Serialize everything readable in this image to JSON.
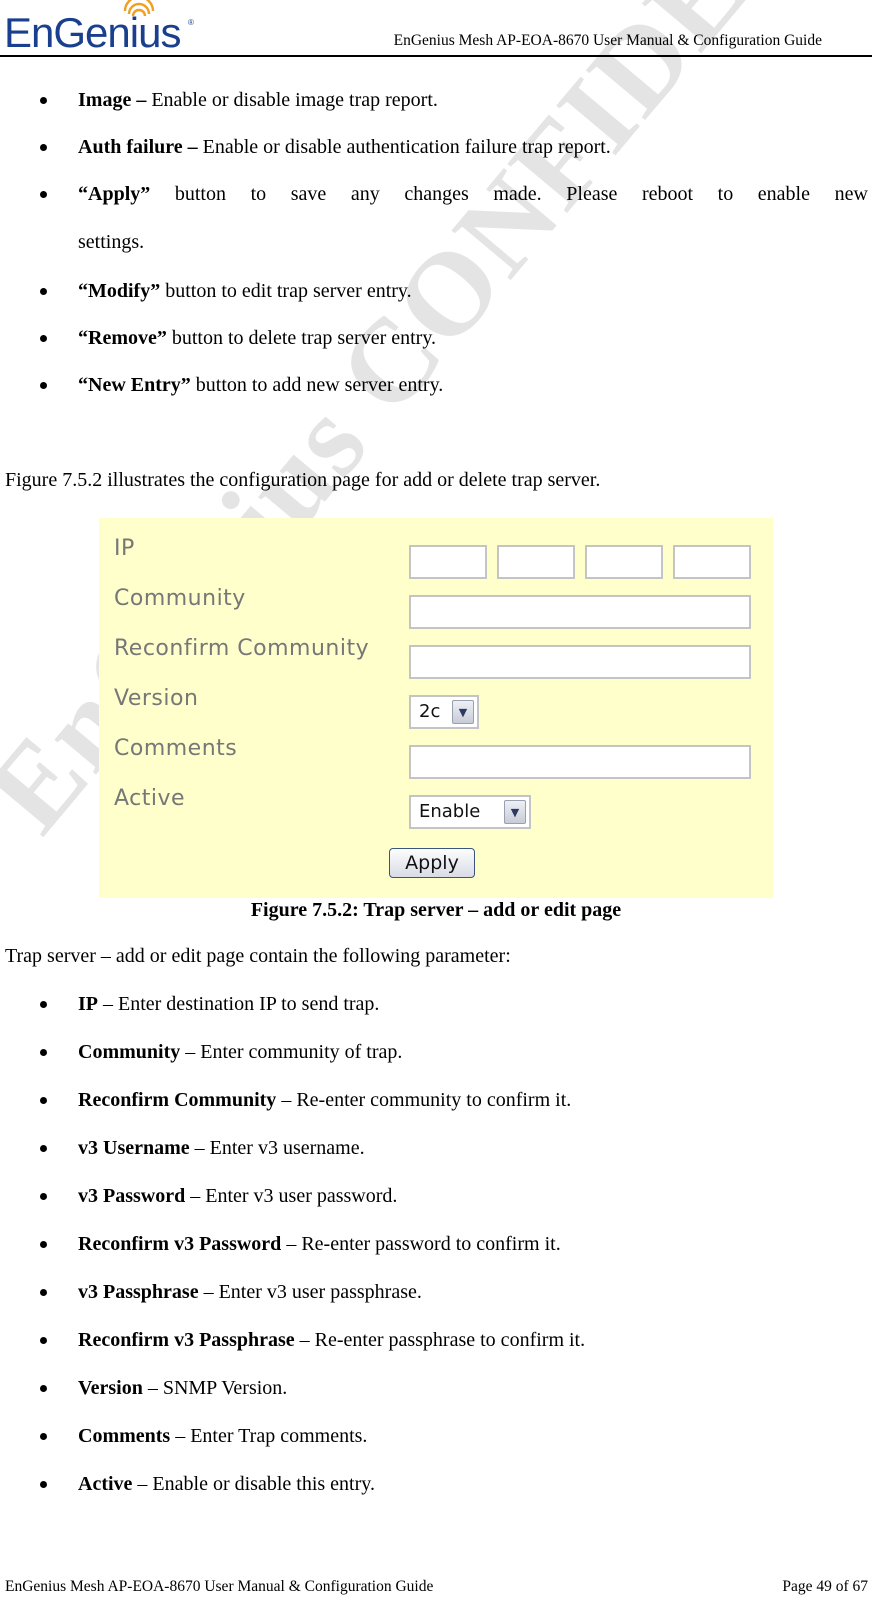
{
  "header": {
    "logo_text": "EnGenius",
    "logo_registered": "®",
    "title": "EnGenius Mesh AP-EOA-8670 User Manual & Configuration Guide"
  },
  "watermark": "EnGenius CONFIDENTIAL",
  "top_bullets": [
    {
      "bold": "Image –",
      "text": " Enable or disable image trap report."
    },
    {
      "bold": "Auth failure –",
      "text": " Enable or disable authentication failure trap report."
    },
    {
      "bold": "“Apply”",
      "text_words": [
        "button",
        "to",
        "save",
        "any",
        "changes",
        "made.",
        "Please",
        "reboot",
        "to",
        "enable",
        "new"
      ],
      "continuation": "settings."
    },
    {
      "bold": "“Modify”",
      "text": " button to edit trap server entry."
    },
    {
      "bold": "“Remove”",
      "text": " button to delete trap server entry."
    },
    {
      "bold": "“New Entry”",
      "text": " button to add new server entry."
    }
  ],
  "intro_paragraph": "Figure 7.5.2 illustrates the configuration page for add or delete trap server.",
  "figure": {
    "colors": {
      "background": "#ffffcc",
      "label": "#777777"
    },
    "fields": [
      {
        "label": "IP",
        "type": "ip",
        "values": [
          "",
          "",
          "",
          ""
        ]
      },
      {
        "label": "Community",
        "type": "text",
        "value": ""
      },
      {
        "label": "Reconfirm Community",
        "type": "text",
        "value": ""
      },
      {
        "label": "Version",
        "type": "select",
        "value": "2c"
      },
      {
        "label": "Comments",
        "type": "text",
        "value": ""
      },
      {
        "label": "Active",
        "type": "select",
        "value": "Enable"
      }
    ],
    "apply_label": "Apply",
    "caption": "Figure 7.5.2: Trap server – add or edit page"
  },
  "params_intro": "Trap server – add or edit page contain the following parameter:",
  "params": [
    {
      "bold": "IP",
      "text": " – Enter destination IP to send trap."
    },
    {
      "bold": "Community",
      "text": " – Enter community of trap."
    },
    {
      "bold": "Reconfirm Community",
      "text": " – Re-enter community to confirm it."
    },
    {
      "bold": "v3 Username",
      "text": " – Enter v3 username."
    },
    {
      "bold": "v3 Password",
      "text": " – Enter v3 user password."
    },
    {
      "bold": "Reconfirm v3 Password",
      "text": " – Re-enter password to confirm it."
    },
    {
      "bold": "v3 Passphrase",
      "text": " – Enter v3 user passphrase."
    },
    {
      "bold": "Reconfirm v3 Passphrase",
      "text": " – Re-enter passphrase to confirm it."
    },
    {
      "bold": "Version",
      "text": " – SNMP Version."
    },
    {
      "bold": "Comments",
      "text": " – Enter Trap comments."
    },
    {
      "bold": "Active",
      "text": " – Enable or disable this entry."
    }
  ],
  "footer": {
    "left": "EnGenius Mesh AP-EOA-8670 User Manual & Configuration Guide",
    "right": "Page 49 of 67"
  }
}
